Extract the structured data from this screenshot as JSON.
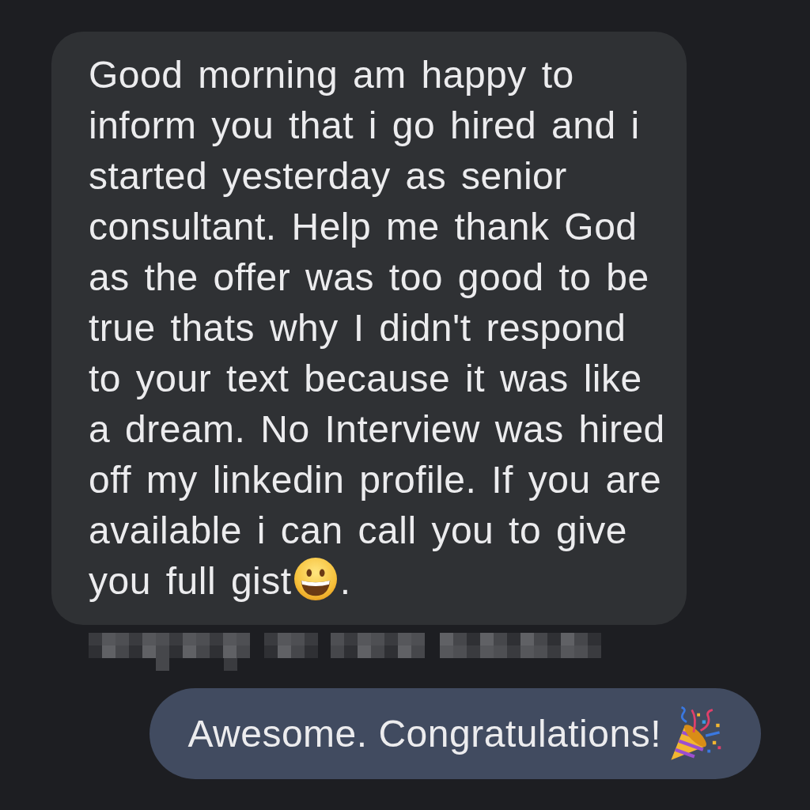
{
  "messages": [
    {
      "kind": "incoming",
      "text": "Good morning am happy to inform you that i go hired and i started yesterday as senior consultant. Help me thank God as the offer was too good to be true thats why I didn't respond to your text because it was like a dream. No Interview was hired off my linkedin profile. If you are available i can call you to give you full gist",
      "text_end": "."
    },
    {
      "kind": "outgoing",
      "text": "Awesome. Congratulations!"
    }
  ]
}
